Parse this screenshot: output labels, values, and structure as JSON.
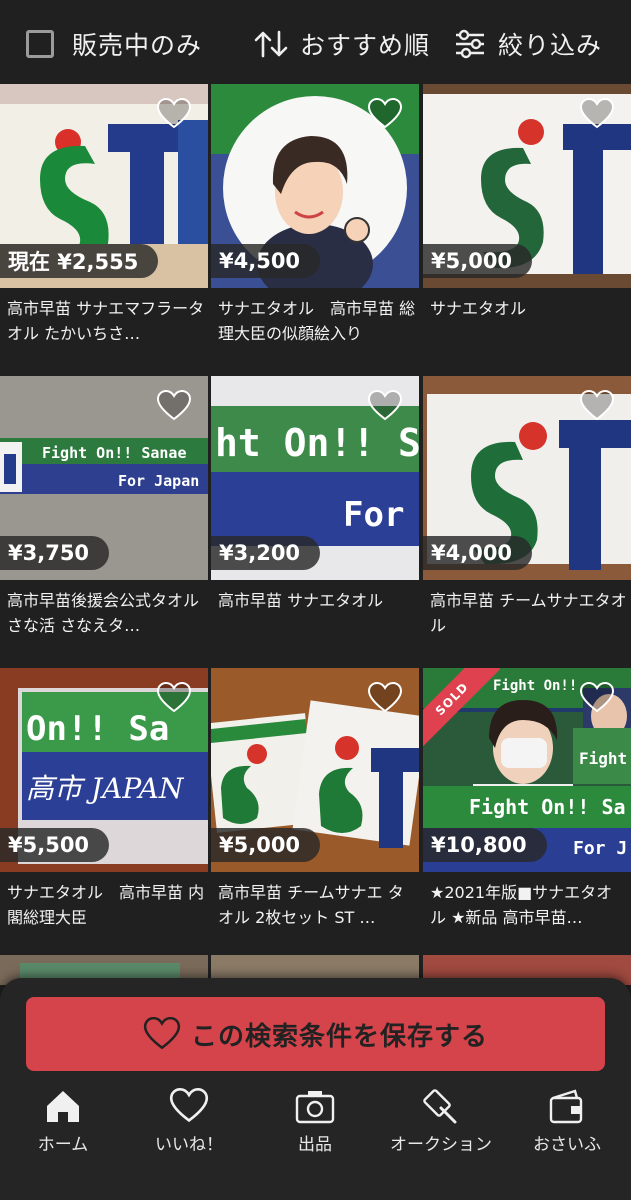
{
  "filters": {
    "on_sale_only_label": "販売中のみ",
    "sort_label": "おすすめ順",
    "refine_label": "絞り込み"
  },
  "items": [
    {
      "price": "現在 ¥2,555",
      "title": "高市早苗 サナエマフラータオル たかいちさ…",
      "sold": false
    },
    {
      "price": "¥4,500",
      "title": "サナエタオル　高市早苗 総理大臣の似顔絵入り",
      "sold": false
    },
    {
      "price": "¥5,000",
      "title": "サナエタオル",
      "sold": false
    },
    {
      "price": "¥3,750",
      "title": "高市早苗後援会公式タオル　さな活 さなえタ…",
      "sold": false
    },
    {
      "price": "¥3,200",
      "title": "高市早苗 サナエタオル",
      "sold": false
    },
    {
      "price": "¥4,000",
      "title": "高市早苗 チームサナエタオル",
      "sold": false
    },
    {
      "price": "¥5,500",
      "title": "サナエタオル　高市早苗 内閣総理大臣",
      "sold": false
    },
    {
      "price": "¥5,000",
      "title": "高市早苗 チームサナエ タオル 2枚セット ST …",
      "sold": false
    },
    {
      "price": "¥10,800",
      "title": "★2021年版■サナエタオル ★新品 高市早苗…",
      "sold": true,
      "sold_label": "SOLD"
    }
  ],
  "towel_text": {
    "st_logo": "ST",
    "fight_on": "Fight On!! Sanae",
    "for_japan": "For Japan",
    "ht_on": "ht On!! Sa",
    "for": "For",
    "on_sa": "On!! Sa",
    "japan_kanji": "高市 JAPAN",
    "fight_on_short": "Fight On!!",
    "fight_on_sa": "Fight On!! Sa",
    "for_j": "For J",
    "fight": "Fight"
  },
  "save_search": {
    "label": "この検索条件を保存する"
  },
  "nav": [
    {
      "label": "ホーム",
      "icon": "home-icon"
    },
    {
      "label": "いいね！",
      "icon": "heart-icon"
    },
    {
      "label": "出品",
      "icon": "camera-icon"
    },
    {
      "label": "オークション",
      "icon": "gavel-icon"
    },
    {
      "label": "おさいふ",
      "icon": "wallet-icon"
    }
  ],
  "colors": {
    "background": "#202020",
    "accent": "#d6444b",
    "price_bg": "#282828",
    "sold_red": "#e0414f"
  }
}
